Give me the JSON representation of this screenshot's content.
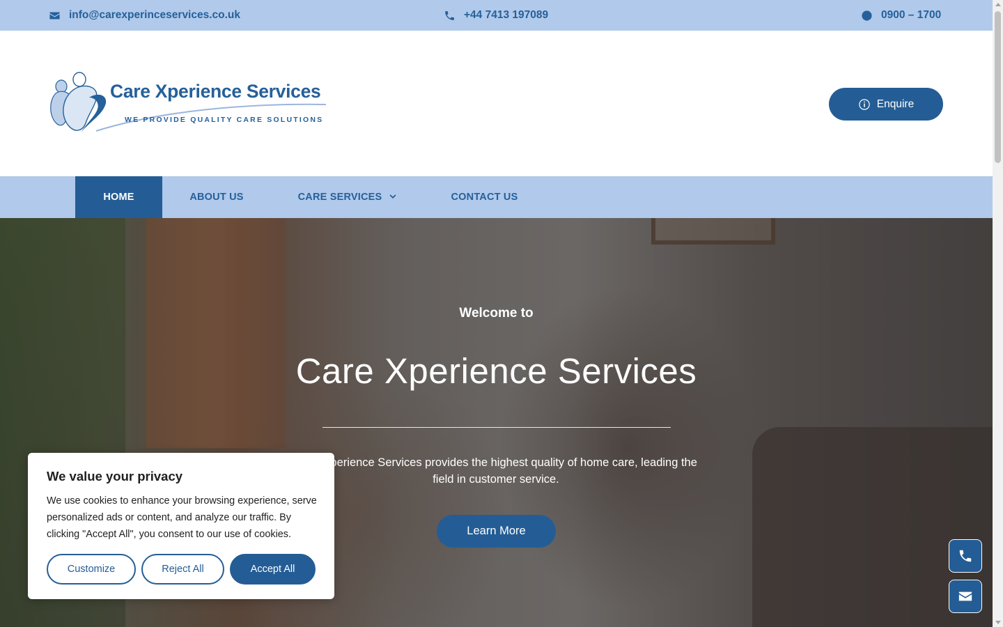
{
  "topbar": {
    "email": "info@carexperinceservices.co.uk",
    "phone": "+44 7413 197089",
    "hours": "0900 – 1700"
  },
  "header": {
    "logo_name": "Care Xperience Services",
    "logo_tagline": "WE PROVIDE QUALITY CARE SOLUTIONS",
    "enquire_label": "Enquire"
  },
  "nav": {
    "items": [
      {
        "label": "HOME",
        "active": true
      },
      {
        "label": "ABOUT US",
        "active": false
      },
      {
        "label": "CARE SERVICES",
        "active": false,
        "has_dropdown": true
      },
      {
        "label": "CONTACT US",
        "active": false
      }
    ]
  },
  "hero": {
    "welcome": "Welcome to",
    "title": "Care Xperience Services",
    "description": "Care Xperience Services provides the highest quality of home care, leading the field in customer service.",
    "cta_label": "Learn More"
  },
  "cookie_banner": {
    "title": "We value your privacy",
    "text": "We use cookies to enhance your browsing experience, serve personalized ads or content, and analyze our traffic. By clicking \"Accept All\", you consent to our use of cookies.",
    "customize_label": "Customize",
    "reject_label": "Reject All",
    "accept_label": "Accept All"
  },
  "floating_buttons": {
    "phone_icon": "phone-icon",
    "email_icon": "envelope-icon"
  },
  "colors": {
    "brand_blue": "#245d95",
    "light_blue": "#b1c9ea",
    "white": "#ffffff"
  }
}
